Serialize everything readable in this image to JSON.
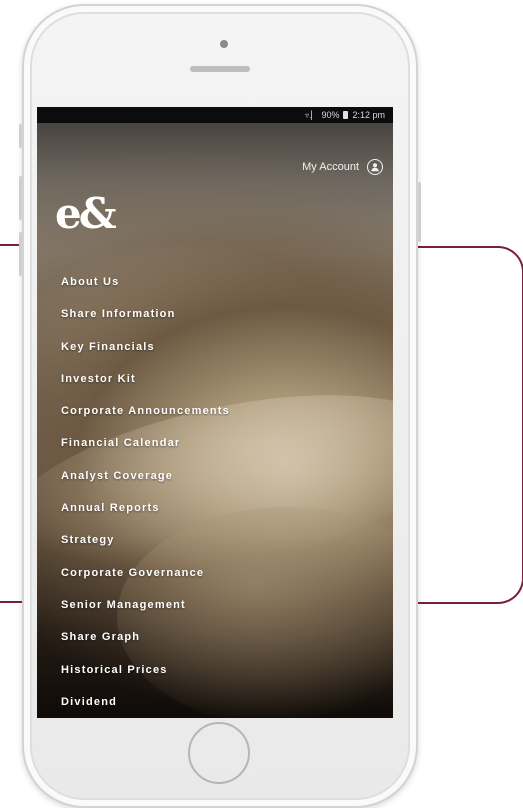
{
  "accent_color": "#7a1f3d",
  "status_bar": {
    "signal_icons": "▿.▏",
    "battery_percent": "90%",
    "time": "2:12 pm"
  },
  "header": {
    "account_label": "My Account",
    "account_icon": "user-circle-icon",
    "logo_text": "e&"
  },
  "menu": {
    "items": [
      {
        "label": "About Us"
      },
      {
        "label": "Share Information"
      },
      {
        "label": "Key Financials"
      },
      {
        "label": "Investor Kit"
      },
      {
        "label": "Corporate Announcements"
      },
      {
        "label": "Financial Calendar"
      },
      {
        "label": "Analyst Coverage"
      },
      {
        "label": "Annual Reports"
      },
      {
        "label": "Strategy"
      },
      {
        "label": "Corporate Governance"
      },
      {
        "label": "Senior Management"
      },
      {
        "label": "Share Graph"
      },
      {
        "label": "Historical Prices"
      },
      {
        "label": "Dividend"
      }
    ]
  }
}
